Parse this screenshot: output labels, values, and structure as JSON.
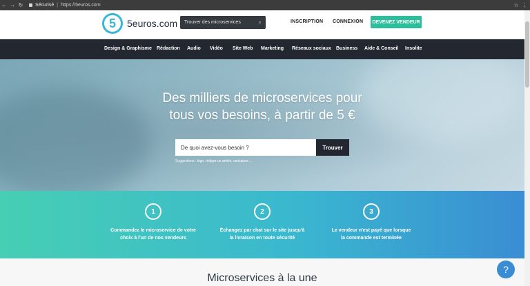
{
  "browser": {
    "security_label": "Sécurisé",
    "url": "https://5euros.com"
  },
  "header": {
    "logo_mark": "5",
    "logo_text": "5euros.com",
    "search_placeholder": "Trouver des microservices",
    "inscription": "INSCRIPTION",
    "connexion": "CONNEXION",
    "cta": "DEVENEZ VENDEUR"
  },
  "categories": [
    "Design & Graphisme",
    "Rédaction",
    "Audio",
    "Vidéo",
    "Site Web",
    "Marketing",
    "Réseaux sociaux",
    "Business",
    "Aide & Conseil",
    "Insolite"
  ],
  "hero": {
    "title_line1": "Des milliers de microservices pour",
    "title_line2": "tous vos besoins, à partir de 5 €",
    "search_placeholder": "De quoi avez-vous besoin ?",
    "search_button": "Trouver",
    "suggestions_label": "Suggestions :",
    "suggestions": "logo, rédiger un article, caricature ..."
  },
  "steps": [
    {
      "num": "1",
      "line1": "Commandez le microservice de votre",
      "line2": "choix à l'un de nos vendeurs"
    },
    {
      "num": "2",
      "line1": "Échangez par chat sur le site jusqu'à",
      "line2": "la livraison en toute sécurité"
    },
    {
      "num": "3",
      "line1": "Le vendeur n'est payé que lorsque",
      "line2": "la commande est terminée"
    }
  ],
  "featured": {
    "title": "Microservices à la une"
  },
  "help": {
    "label": "?"
  },
  "colors": {
    "brand": "#3ab6d6",
    "cta": "#2bbf9c",
    "dark": "#232830"
  }
}
